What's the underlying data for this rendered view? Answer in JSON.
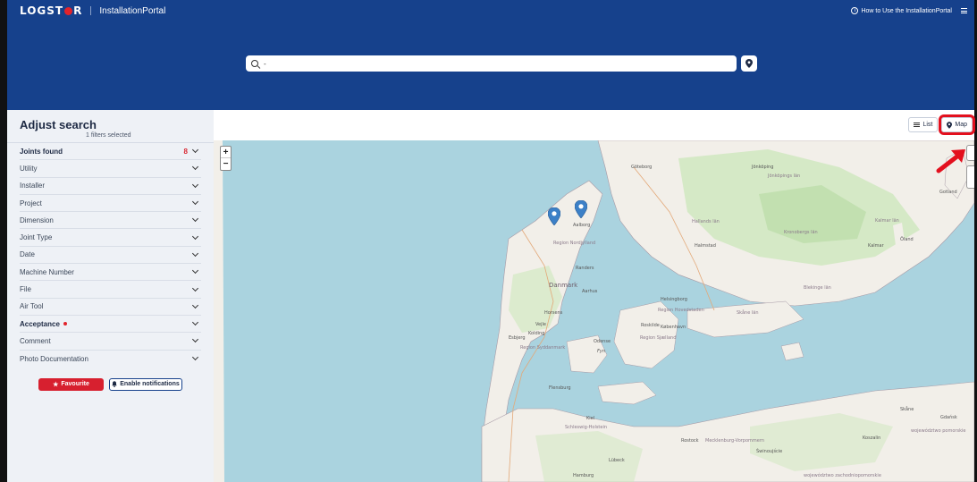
{
  "app": {
    "logo_text": "LOGSTOR",
    "portal_name": "InstallationPortal",
    "help_link": "How to Use the InstallationPortal"
  },
  "search": {
    "value": "-",
    "placeholder": ""
  },
  "sidebar": {
    "title": "Adjust search",
    "subtitle": "1 filters selected",
    "joints_found_label": "Joints found",
    "joints_found_count": "8",
    "filters": [
      {
        "label": "Utility"
      },
      {
        "label": "Installer"
      },
      {
        "label": "Project"
      },
      {
        "label": "Dimension"
      },
      {
        "label": "Joint Type"
      },
      {
        "label": "Date"
      },
      {
        "label": "Machine Number"
      },
      {
        "label": "File"
      },
      {
        "label": "Air Tool"
      },
      {
        "label": "Acceptance",
        "active": true
      },
      {
        "label": "Comment"
      },
      {
        "label": "Photo Documentation"
      }
    ],
    "favourite_button": "Favourite",
    "notifications_button": "Enable notifications"
  },
  "view_toggle": {
    "list_label": "List",
    "map_label": "Map",
    "selected": "Map"
  },
  "map": {
    "zoom_in": "+",
    "zoom_out": "−",
    "labels": {
      "goteborg": "Göteborg",
      "jonkoping": "Jönköping",
      "jonkopings_lan": "Jönköpings län",
      "gotland": "Gotland",
      "halland": "Hallands län",
      "kalmar_lan": "Kalmar län",
      "kronoberg": "Kronobergs län",
      "halmstad": "Halmstad",
      "oland": "Öland",
      "kalmar": "Kalmar",
      "aalborg": "Aalborg",
      "nordjylland": "Region Nordjylland",
      "randers": "Randers",
      "danmark": "Danmark",
      "aarhus": "Aarhus",
      "helsingborg": "Helsingborg",
      "blekinge": "Blekinge län",
      "hovedstaden": "Region Hovedstaden",
      "skane": "Skåne län",
      "horsens": "Horsens",
      "vejle": "Vejle",
      "kolding": "Kolding",
      "roskilde": "Roskilde",
      "kobenhavn": "København",
      "esbjerg": "Esbjerg",
      "syddanmark": "Region Syddanmark",
      "odense": "Odense",
      "fyn": "Fyn",
      "sjaelland": "Region Sjælland",
      "flensburg": "Flensburg",
      "skane_town": "Skåne",
      "kiel": "Kiel",
      "schleswig": "Schleswig-Holstein",
      "rostock": "Rostock",
      "mecklenburg": "Mecklenburg-Vorpommern",
      "swinoujscie": "Świnoujście",
      "lubeck": "Lübeck",
      "hamburg": "Hamburg",
      "gdansk": "Gdańsk",
      "koszalin": "Koszalin",
      "pomorskie": "województwo pomorskie",
      "zachodnio": "województwo zachodniopomorskie"
    },
    "markers": 2
  },
  "colors": {
    "header_bg": "#16418c",
    "accent_red": "#d7202f",
    "sidebar_bg": "#eef1f6",
    "water": "#aad3df",
    "land": "#f2efe9",
    "forest": "#cde7bd"
  }
}
